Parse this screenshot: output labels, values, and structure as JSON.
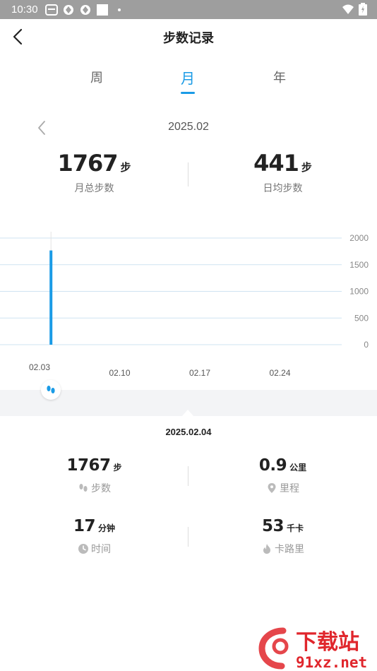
{
  "status_bar": {
    "time": "10:30"
  },
  "header": {
    "title": "步数记录"
  },
  "tabs": [
    {
      "label": "周",
      "active": false
    },
    {
      "label": "月",
      "active": true
    },
    {
      "label": "年",
      "active": false
    }
  ],
  "period": {
    "label": "2025.02"
  },
  "summary": {
    "total": {
      "value": "1767",
      "unit": "步",
      "label": "月总步数"
    },
    "average": {
      "value": "441",
      "unit": "步",
      "label": "日均步数"
    }
  },
  "chart_data": {
    "type": "bar",
    "x": [
      "02.03",
      "02.10",
      "02.17",
      "02.24"
    ],
    "bars": [
      {
        "date": "02.04",
        "value": 1767
      }
    ],
    "yticks": [
      0,
      500,
      1000,
      1500,
      2000
    ],
    "ylim": [
      0,
      2000
    ],
    "bar_color": "#1a9be6",
    "grid": true
  },
  "detail": {
    "date": "2025.02.04",
    "steps": {
      "value": "1767",
      "unit": "步",
      "label": "步数"
    },
    "distance": {
      "value": "0.9",
      "unit": "公里",
      "label": "里程"
    },
    "duration": {
      "value": "17",
      "unit": "分钟",
      "label": "时间"
    },
    "calories": {
      "value": "53",
      "unit": "千卡",
      "label": "卡路里"
    }
  },
  "watermark": {
    "text_top": "下载站",
    "text_bottom": "91xz.net"
  },
  "colors": {
    "accent": "#1a9be6",
    "status_bar": "#9e9e9e",
    "watermark": "#e0262c"
  }
}
